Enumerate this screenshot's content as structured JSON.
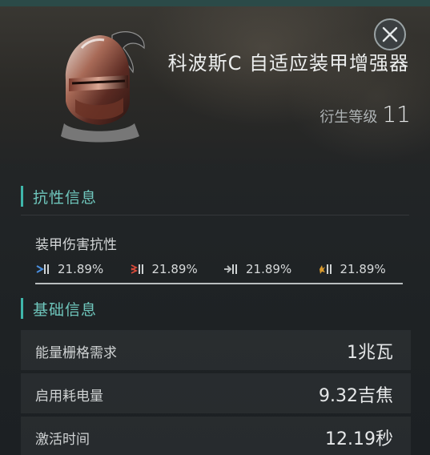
{
  "item": {
    "name": "科波斯C 自适应装甲增强器",
    "meta_label": "衍生等级",
    "meta_level": "11"
  },
  "resist_section": {
    "title": "抗性信息",
    "label": "装甲伤害抗性",
    "values": [
      {
        "type": "em-icon",
        "value": "21.89%"
      },
      {
        "type": "thermal-icon",
        "value": "21.89%"
      },
      {
        "type": "kinetic-icon",
        "value": "21.89%"
      },
      {
        "type": "explosive-icon",
        "value": "21.89%"
      }
    ]
  },
  "basic_section": {
    "title": "基础信息",
    "rows": [
      {
        "label": "能量栅格需求",
        "value": "1兆瓦"
      },
      {
        "label": "启用耗电量",
        "value": "9.32吉焦"
      },
      {
        "label": "激活时间",
        "value": "12.19秒"
      }
    ]
  },
  "colors": {
    "accent": "#3fb6ab",
    "section_text": "#6fc7bd",
    "background": "#1f2325"
  }
}
